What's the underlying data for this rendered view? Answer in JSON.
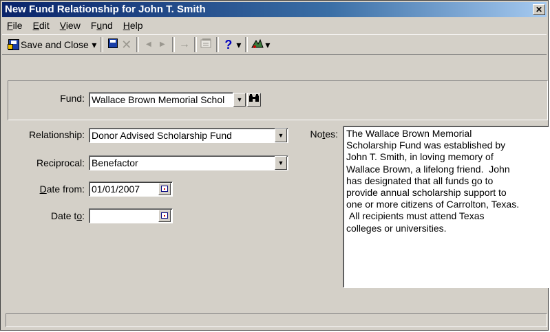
{
  "window": {
    "title": "New Fund Relationship for John T. Smith",
    "close_glyph": "✕"
  },
  "menu": [
    {
      "pre": "",
      "key": "F",
      "post": "ile"
    },
    {
      "pre": "",
      "key": "E",
      "post": "dit"
    },
    {
      "pre": "",
      "key": "V",
      "post": "iew"
    },
    {
      "pre": "F",
      "key": "u",
      "post": "nd"
    },
    {
      "pre": "",
      "key": "H",
      "post": "elp"
    }
  ],
  "toolbar": {
    "save_close_label": "Save and Close",
    "dropdown_glyph": "▾",
    "delete_glyph": "✕",
    "prev_glyph": "◀",
    "next_glyph": "▶",
    "goto_glyph": "→",
    "help_glyph": "?",
    "icons": [
      "save-and-close-icon",
      "save-disk-icon",
      "delete-icon",
      "previous-icon",
      "next-icon",
      "go-to-icon",
      "properties-icon",
      "help-icon",
      "crystal-tools-icon"
    ]
  },
  "form": {
    "fund_label": "Fund:",
    "fund_value": "Wallace Brown Memorial Schol",
    "search_glyph": "👁",
    "relationship_label": "Relationship:",
    "relationship_value": "Donor Advised Scholarship Fund",
    "reciprocal_label": "Reciprocal:",
    "reciprocal_value": "Benefactor",
    "date_from_key": "D",
    "date_from_rest": "ate from:",
    "date_from_value": "01/01/2007",
    "date_to_pre": "Date t",
    "date_to_key": "o",
    "date_to_post": ":",
    "date_to_value": "",
    "notes_pre": "No",
    "notes_key": "t",
    "notes_post": "es:",
    "notes_text": "The Wallace Brown Memorial\nScholarship Fund was established by\nJohn T. Smith, in loving memory of\nWallace Brown, a lifelong friend.  John\nhas designated that all funds go to\nprovide annual scholarship support to\none or more citizens of Carrolton, Texas.\n All recipients must attend Texas\ncolleges or universities.",
    "dd_glyph": "▼"
  },
  "status_text": "",
  "colors": {
    "title_start": "#0a246a",
    "title_end": "#a6caf0",
    "face": "#d4d0c8"
  }
}
